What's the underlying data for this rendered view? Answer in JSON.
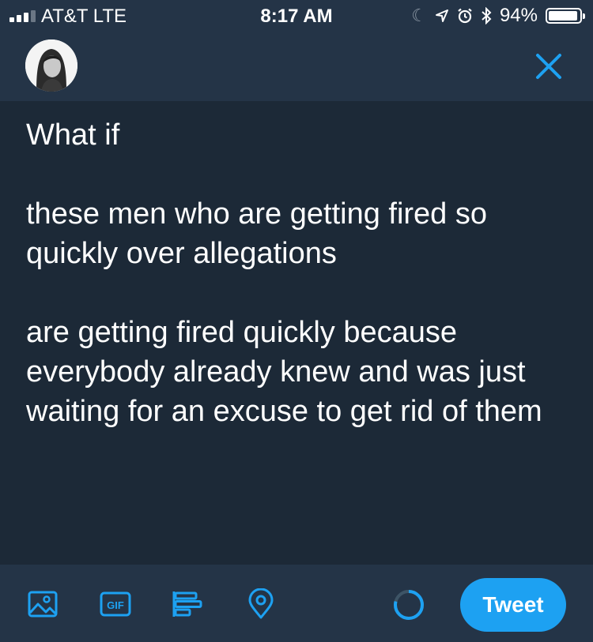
{
  "status_bar": {
    "carrier": "AT&T  LTE",
    "time": "8:17 AM",
    "battery_percent": "94%",
    "battery_level": 0.94,
    "icons": [
      "signal-icon",
      "moon-icon",
      "location-icon",
      "alarm-icon",
      "bluetooth-icon",
      "battery-icon"
    ]
  },
  "header": {
    "avatar_icon": "profile-avatar",
    "close_icon": "close-icon"
  },
  "composer": {
    "paragraphs": [
      "What if",
      "these men who are getting fired so quickly over allegations",
      "are getting fired quickly because everybody already knew and was just waiting for an excuse to get rid of them"
    ]
  },
  "toolbar": {
    "icons": [
      "image-icon",
      "gif-icon",
      "poll-icon",
      "location-pin-icon",
      "character-count-ring"
    ],
    "gif_label": "GIF",
    "tweet_label": "Tweet",
    "character_count_ratio": 0.79
  },
  "colors": {
    "background": "#1c2937",
    "bar": "#243447",
    "accent": "#1da1f2",
    "text": "#ffffff"
  }
}
